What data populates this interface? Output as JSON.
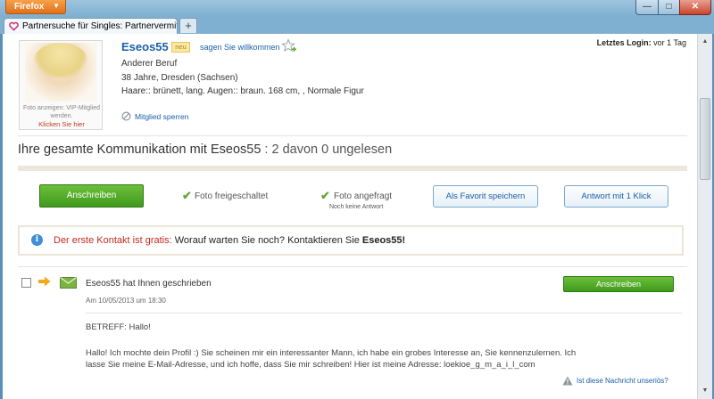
{
  "browser": {
    "app_button": "Firefox",
    "tab_title": "Partnersuche für Singles: Partnervermittl...",
    "new_tab": "+",
    "minimize": "—",
    "maximize": "□",
    "close": "✕"
  },
  "profile": {
    "username": "Eseos55",
    "new_badge": "neu",
    "welcome_link": "sagen Sie willkommen",
    "last_login_label": "Letztes Login:",
    "last_login_value": " vor 1 Tag",
    "job": "Anderer Beruf",
    "age_location": "38 Jahre, Dresden (Sachsen)",
    "physical": "Haare:: brünett, lang. Augen:: braun. 168 cm, , Normale Figur",
    "block_link": "Mitglied sperren",
    "photo_caption": "Foto anzeigen: VIP-Mitglied werden.",
    "photo_link": "Klicken Sie hier"
  },
  "communication": {
    "title_prefix": "Ihre gesamte Kommunikation mit Eseos55",
    "title_count": " : 2 davon 0 ungelesen"
  },
  "actions": {
    "write_button": "Anschreiben",
    "photo_unlocked": "Foto freigeschaltet",
    "photo_requested": "Foto angefragt",
    "no_response": "Noch keine Antwort",
    "save_favorite": "Als Favorit speichern",
    "quick_reply": "Antwort mit 1 Klick"
  },
  "info": {
    "red_text": "Der erste Kontakt ist gratis:",
    "dark_text": " Worauf warten Sie noch? Kontaktieren Sie ",
    "name": "Eseos55!"
  },
  "message": {
    "from": "Eseos55 hat Ihnen geschrieben",
    "date": "Am 10/05/2013 um 18:30",
    "write_button": "Anschreiben",
    "subject": "BETREFF: Hallo!",
    "body_line1": "Hallo! Ich mochte dein Profil :) Sie scheinen mir ein interessanter Mann, ich habe ein grobes Interesse an, Sie kennenzulernen. Ich",
    "body_line2": "lasse Sie meine E-Mail-Adresse, und ich hoffe, dass Sie mir schreiben! Hier ist meine Adresse: loekioe_g_m_a_i_l_com",
    "report_link": "Ist diese Nachricht unseriös?"
  },
  "colors": {
    "link_blue": "#1a5fa8",
    "green_button": "#4fa826",
    "info_red": "#c32a1d"
  }
}
